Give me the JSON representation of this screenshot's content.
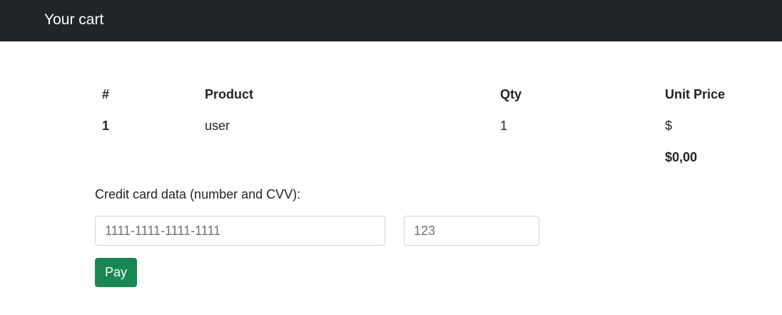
{
  "header": {
    "title": "Your cart"
  },
  "cart": {
    "columns": [
      "#",
      "Product",
      "Qty",
      "Unit Price"
    ],
    "rows": [
      {
        "num": "1",
        "product": "user",
        "qty": "1",
        "unit_price": "$"
      }
    ],
    "total": "$0,00"
  },
  "payment": {
    "label": "Credit card data (number and CVV):",
    "card_number_placeholder": "1111-1111-1111-1111",
    "cvv_placeholder": "123",
    "pay_label": "Pay"
  },
  "colors": {
    "navbar": "#212529",
    "pay_button": "#198754"
  }
}
